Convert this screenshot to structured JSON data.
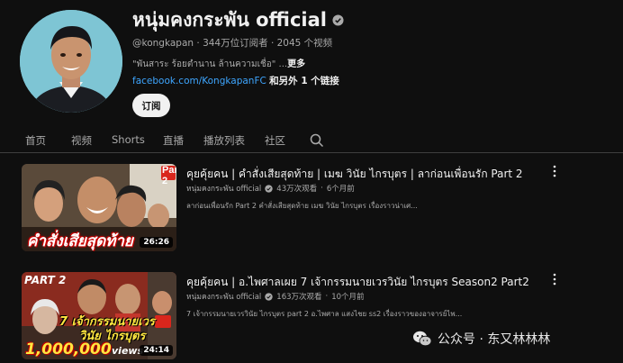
{
  "channel": {
    "name": "หนุ่มคงกระพัน official",
    "handle": "@kongkapan",
    "subscribers": "344万位订阅者",
    "video_count": "2045 个视频",
    "separator": " · ",
    "description": "\"พันสาระ ร้อยตำนาน ล้านความเชื่อ\" ...",
    "more_label": "更多",
    "link_url": "facebook.com/KongkapanFC",
    "link_extra": "和另外 1 个链接",
    "subscribe_label": "订阅"
  },
  "tabs": [
    {
      "label": "首页"
    },
    {
      "label": "视频"
    },
    {
      "label": "Shorts"
    },
    {
      "label": "直播"
    },
    {
      "label": "播放列表"
    },
    {
      "label": "社区"
    }
  ],
  "videos": [
    {
      "title": "คุยคุ้ยคน | คำสั่งเสียสุดท้าย | เมฆ วินัย ไกรบุตร | ลาก่อนเพื่อนรัก Part 2",
      "channel": "หนุ่มคงกระพัน official",
      "views": "43万次观看",
      "age": "6个月前",
      "description": "ลาก่อนเพื่อนรัก Part 2 คำสั่งเสียสุดท้าย เมฆ วินัย ไกรบุตร เรื่องราวน่าเศ...",
      "duration": "26:26",
      "thumb_badge": "Part 2",
      "thumb_caption": "คำสั่งเสียสุดท้าย"
    },
    {
      "title": "คุยคุ้ยคน | อ.ไพศาลเผย 7 เจ้ากรรมนายเวรวินัย ไกรบุตร Season2 Part2",
      "channel": "หนุ่มคงกระพัน official",
      "views": "163万次观看",
      "age": "10个月前",
      "description": "7 เจ้ากรรมนายเวรวินัย ไกรบุตร part 2 อ.ไพศาล แสงไชย ss2 เรื่องราวของอาจารย์ไพ...",
      "duration": "24:14",
      "thumb_badge": "PART 2",
      "thumb_caption": "7 เจ้ากรรมนายเวร",
      "thumb_caption2": "วินัย ไกรบุตร",
      "thumb_views": "1,000,000",
      "thumb_views_word": "views"
    }
  ],
  "watermark": "公众号 · 东又林林林"
}
